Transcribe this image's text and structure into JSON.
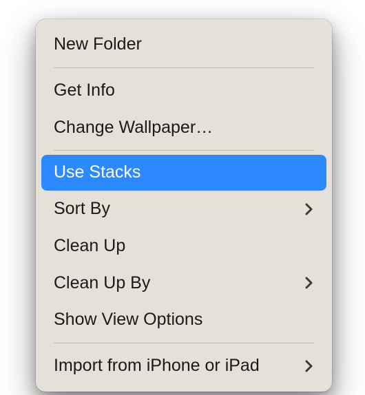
{
  "menu": {
    "items": [
      {
        "label": "New Folder",
        "submenu": false,
        "highlighted": false
      },
      {
        "divider": true
      },
      {
        "label": "Get Info",
        "submenu": false,
        "highlighted": false
      },
      {
        "label": "Change Wallpaper…",
        "submenu": false,
        "highlighted": false
      },
      {
        "divider": true
      },
      {
        "label": "Use Stacks",
        "submenu": false,
        "highlighted": true
      },
      {
        "label": "Sort By",
        "submenu": true,
        "highlighted": false
      },
      {
        "label": "Clean Up",
        "submenu": false,
        "highlighted": false
      },
      {
        "label": "Clean Up By",
        "submenu": true,
        "highlighted": false
      },
      {
        "label": "Show View Options",
        "submenu": false,
        "highlighted": false
      },
      {
        "divider": true
      },
      {
        "label": "Import from iPhone or iPad",
        "submenu": true,
        "highlighted": false
      }
    ]
  }
}
